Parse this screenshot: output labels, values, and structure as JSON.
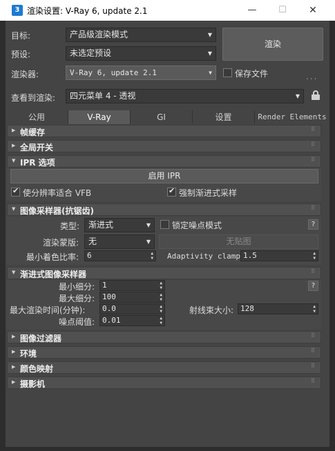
{
  "window": {
    "title": "渲染设置: V-Ray 6, update 2.1",
    "app_icon_text": "3",
    "minimize_icon": "minimize-icon",
    "maximize_icon": "maximize-icon",
    "close_icon": "close-icon"
  },
  "header": {
    "target_label": "目标:",
    "target_value": "产品级渲染模式",
    "preset_label": "预设:",
    "preset_value": "未选定预设",
    "renderer_label": "渲染器:",
    "renderer_value": "V-Ray 6, update 2.1",
    "save_file_label": "保存文件",
    "save_file_checked": false,
    "dots": "...",
    "view_label": "查看到渲染:",
    "view_value": "四元菜单 4 - 透视",
    "render_button": "渲染"
  },
  "tabs": [
    {
      "label": "公用",
      "active": false
    },
    {
      "label": "V-Ray",
      "active": true
    },
    {
      "label": "GI",
      "active": false
    },
    {
      "label": "设置",
      "active": false
    },
    {
      "label": "Render Elements",
      "active": false
    }
  ],
  "rollouts": {
    "frame_buffer": "帧缓存",
    "global_switches": "全局开关",
    "ipr": {
      "title": "IPR 选项",
      "enable_button": "启用 IPR",
      "fit_resolution_label": "使分辨率适合 VFB",
      "fit_resolution_checked": true,
      "force_progressive_label": "强制渐进式采样",
      "force_progressive_checked": true
    },
    "image_sampler": {
      "title": "图像采样器(抗锯齿)",
      "type_label": "类型:",
      "type_value": "渐进式",
      "lock_noise_label": "锁定噪点模式",
      "lock_noise_checked": false,
      "help": "?",
      "render_mask_label": "渲染蒙版:",
      "render_mask_value": "无",
      "no_map_button": "无贴图",
      "min_shading_label": "最小着色比率:",
      "min_shading_value": "6",
      "adaptivity_label": "Adaptivity clamp:",
      "adaptivity_value": "1.5"
    },
    "progressive": {
      "title": "渐进式图像采样器",
      "min_subdivs_label": "最小细分:",
      "min_subdivs_value": "1",
      "max_subdivs_label": "最大细分:",
      "max_subdivs_value": "100",
      "max_time_label": "最大渲染时间(分钟):",
      "max_time_value": "0.0",
      "bundle_size_label": "射线束大小:",
      "bundle_size_value": "128",
      "noise_threshold_label": "噪点阈值:",
      "noise_threshold_value": "0.01",
      "help": "?"
    },
    "image_filter": "图像过滤器",
    "environment": "环境",
    "color_mapping": "颜色映射",
    "camera": "摄影机"
  }
}
